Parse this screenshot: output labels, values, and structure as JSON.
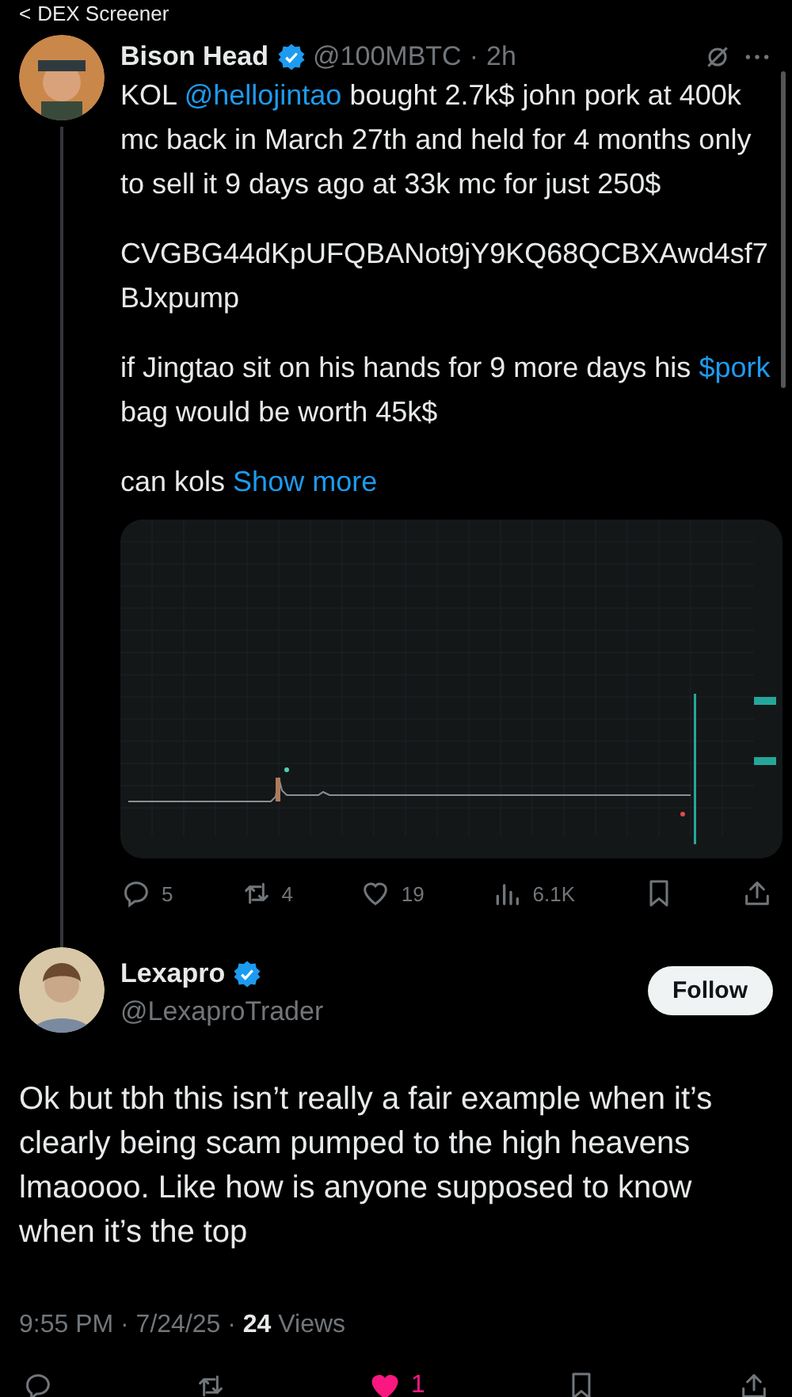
{
  "header": {
    "back": "<",
    "title": "DEX Screener"
  },
  "post": {
    "name": "Bison Head",
    "verified": true,
    "handle": "@100MBTC",
    "separator": "·",
    "time": "2h",
    "paragraphs": [
      [
        {
          "kind": "text",
          "text": "KOL "
        },
        {
          "kind": "link",
          "text": "@hellojintao"
        },
        {
          "kind": "text",
          "text": " bought 2.7k$ john pork at 400k mc back in March 27th and held for 4 months only to sell it 9 days ago at 33k mc for just 250$"
        }
      ],
      [
        {
          "kind": "text",
          "text": "CVGBG44dKpUFQBANot9jY9KQ68QCBXAwd4sf7BJxpump"
        }
      ],
      [
        {
          "kind": "text",
          "text": "if Jingtao sit on his hands for 9 more days his "
        },
        {
          "kind": "link",
          "text": "$pork"
        },
        {
          "kind": "text",
          "text": " bag would be worth 45k$"
        }
      ],
      [
        {
          "kind": "text",
          "text": "can kols "
        },
        {
          "kind": "link",
          "text": "Show more"
        }
      ]
    ],
    "media": {
      "kind": "picture"
    },
    "actions": [
      {
        "kind": "reply",
        "count": "5"
      },
      {
        "kind": "repost",
        "count": "4"
      },
      {
        "kind": "like",
        "count": "19",
        "liked": false
      },
      {
        "kind": "views",
        "count": "6.1K"
      },
      {
        "kind": "bookmark"
      },
      {
        "kind": "share"
      }
    ]
  },
  "reply": {
    "name": "Lexapro",
    "verified": true,
    "handle": "@LexaproTrader",
    "follow": "Follow",
    "text": "Ok but tbh this isn’t really a fair example when it’s clearly being scam pumped to the high heavens lmaoooo. Like how is anyone supposed to know when it’s the top",
    "meta": "9:55 PM · 7/24/25 · **24** Views",
    "actions": [
      {
        "kind": "reply"
      },
      {
        "kind": "repost"
      },
      {
        "kind": "like",
        "count": "1",
        "liked": true
      },
      {
        "kind": "bookmark"
      },
      {
        "kind": "share"
      }
    ]
  }
}
